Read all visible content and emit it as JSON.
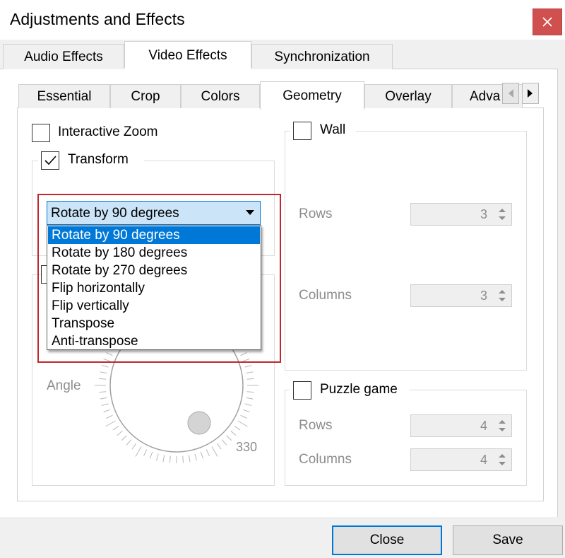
{
  "window": {
    "title": "Adjustments and Effects"
  },
  "main_tabs": [
    {
      "label": "Audio Effects"
    },
    {
      "label": "Video Effects"
    },
    {
      "label": "Synchronization"
    }
  ],
  "sub_tabs": [
    {
      "label": "Essential"
    },
    {
      "label": "Crop"
    },
    {
      "label": "Colors"
    },
    {
      "label": "Geometry"
    },
    {
      "label": "Overlay"
    },
    {
      "label": "Adva"
    }
  ],
  "geometry": {
    "interactive_zoom": {
      "label": "Interactive Zoom",
      "checked": false
    },
    "transform": {
      "label": "Transform",
      "checked": true,
      "selected": "Rotate by 90 degrees",
      "options": [
        "Rotate by 90 degrees",
        "Rotate by 180 degrees",
        "Rotate by 270 degrees",
        "Flip horizontally",
        "Flip vertically",
        "Transpose",
        "Anti-transpose"
      ]
    },
    "rotate": {
      "angle_label": "Angle",
      "angle_value": "330"
    },
    "wall": {
      "label": "Wall",
      "checked": false,
      "rows_label": "Rows",
      "rows_value": "3",
      "columns_label": "Columns",
      "columns_value": "3"
    },
    "puzzle": {
      "label": "Puzzle game",
      "checked": false,
      "rows_label": "Rows",
      "rows_value": "4",
      "columns_label": "Columns",
      "columns_value": "4"
    }
  },
  "buttons": {
    "close": "Close",
    "save": "Save"
  },
  "colors": {
    "selection": "#0078d7",
    "highlight": "#c1272d",
    "close_button": "#d0504f"
  }
}
